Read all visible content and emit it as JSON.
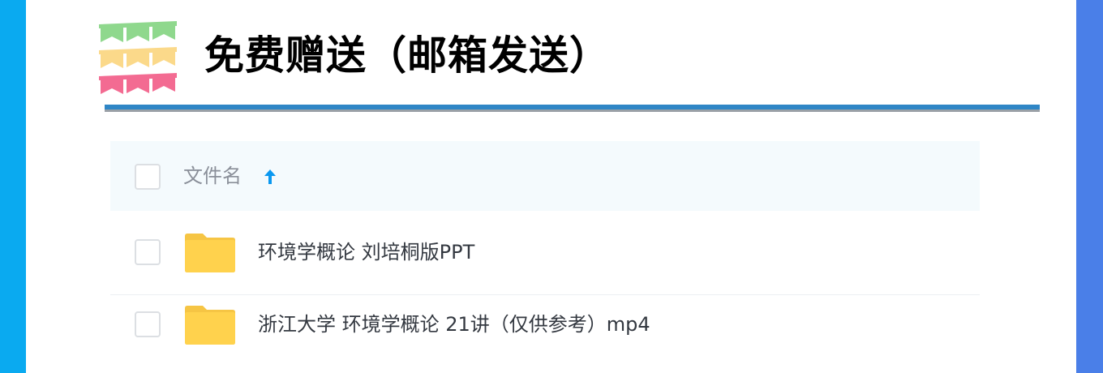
{
  "page": {
    "title": "免费赠送（邮箱发送）",
    "left_stripe_color": "#0aaaf0",
    "right_stripe_color": "#4a7fe8",
    "rule_color": "#2f86c6"
  },
  "bunting": {
    "icon": "bunting-flags-icon",
    "row_colors": [
      "#8fd88d",
      "#fbd98a",
      "#f36b92"
    ]
  },
  "file_list": {
    "header": {
      "column_label": "文件名",
      "sort_icon": "arrow-up-icon",
      "sort_color": "#0a98f0"
    },
    "rows": [
      {
        "name": "环境学概论 刘培桐版PPT",
        "icon": "folder-icon"
      },
      {
        "name": "浙江大学 环境学概论 21讲（仅供参考）mp4",
        "icon": "folder-icon"
      }
    ],
    "folder_color": "#ffd24d"
  }
}
